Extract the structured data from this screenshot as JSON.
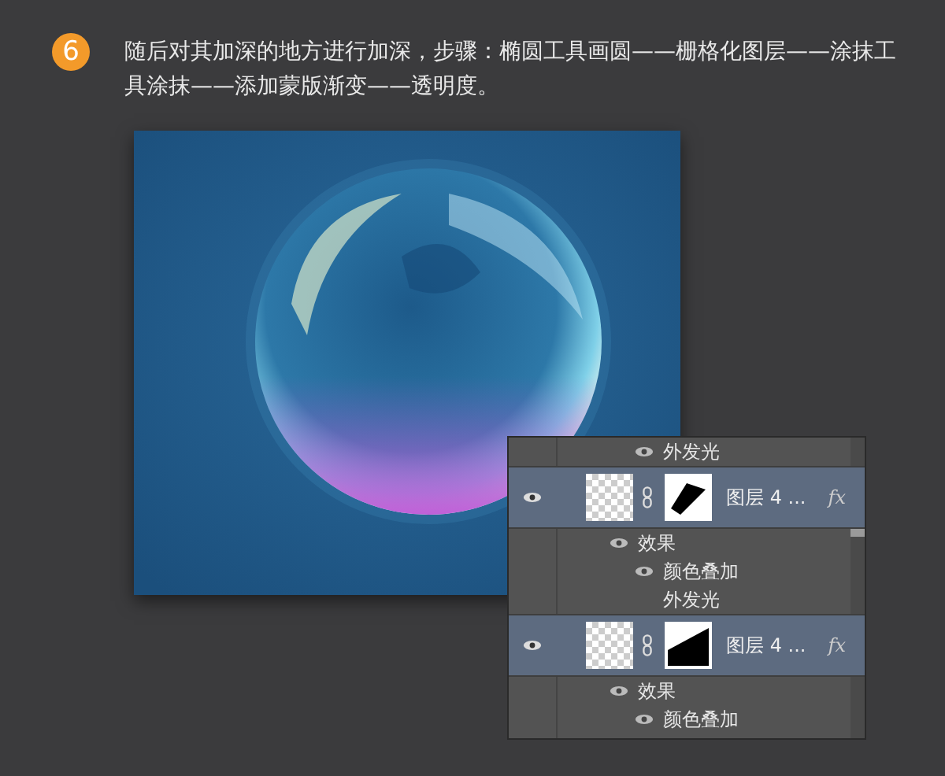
{
  "step": {
    "number": "6",
    "text": "随后对其加深的地方进行加深，步骤：椭圆工具画圆——栅格化图层——涂抹工具涂抹——添加蒙版渐变——透明度。"
  },
  "layers_panel": {
    "items": [
      {
        "kind": "effect",
        "label": "外发光",
        "visible": true
      },
      {
        "kind": "layer",
        "name": "图层 4 ...",
        "selected": true,
        "visible": true,
        "fx": "fx",
        "children": [
          {
            "kind": "group",
            "label": "效果",
            "visible": true,
            "children": [
              {
                "kind": "effect",
                "label": "颜色叠加",
                "visible": true
              },
              {
                "kind": "effect",
                "label": "外发光",
                "visible": false
              }
            ]
          }
        ]
      },
      {
        "kind": "layer",
        "name": "图层 4 ...",
        "selected": true,
        "visible": true,
        "fx": "fx",
        "children": [
          {
            "kind": "group",
            "label": "效果",
            "visible": true,
            "children": [
              {
                "kind": "effect",
                "label": "颜色叠加",
                "visible": true
              }
            ]
          }
        ]
      }
    ]
  }
}
